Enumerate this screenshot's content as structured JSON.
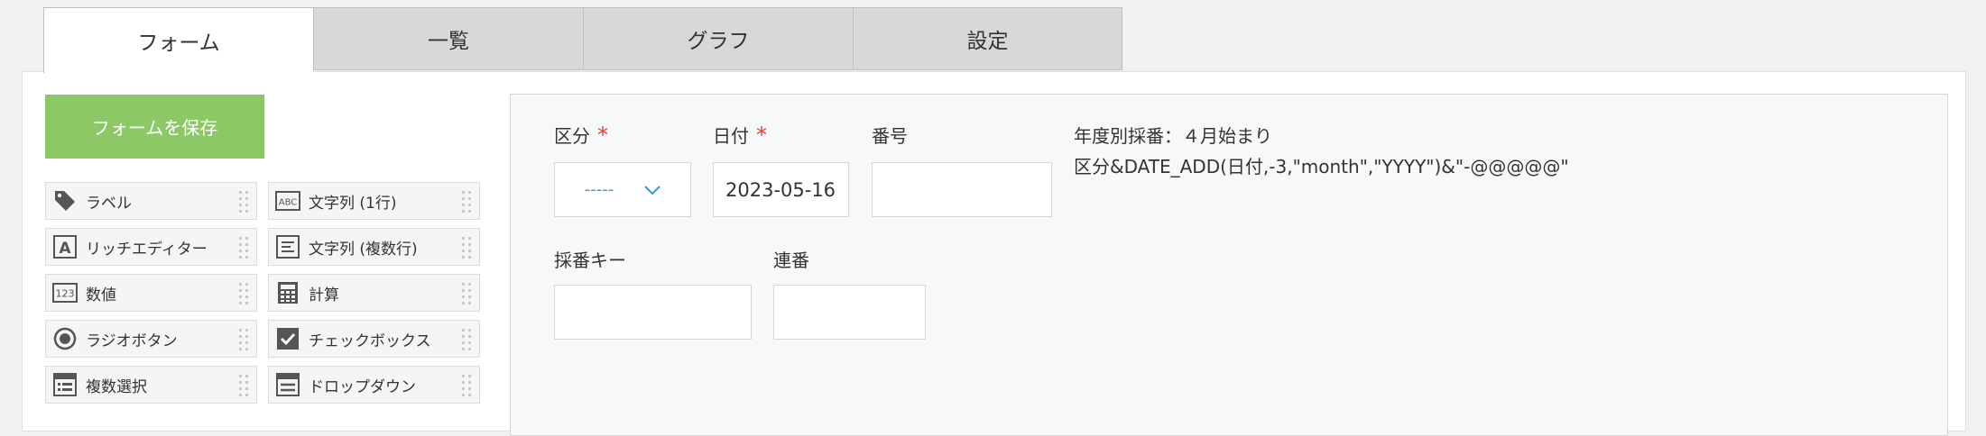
{
  "tabs": [
    {
      "label": "フォーム"
    },
    {
      "label": "一覧"
    },
    {
      "label": "グラフ"
    },
    {
      "label": "設定"
    }
  ],
  "save_button": "フォームを保存",
  "palette": [
    {
      "label": "ラベル",
      "icon": "tag-icon"
    },
    {
      "label": "文字列 (1行)",
      "icon": "abc-icon"
    },
    {
      "label": "リッチエディター",
      "icon": "rich-editor-icon"
    },
    {
      "label": "文字列 (複数行)",
      "icon": "multiline-text-icon"
    },
    {
      "label": "数値",
      "icon": "number-123-icon"
    },
    {
      "label": "計算",
      "icon": "calculator-icon"
    },
    {
      "label": "ラジオボタン",
      "icon": "radio-icon"
    },
    {
      "label": "チェックボックス",
      "icon": "checkbox-icon"
    },
    {
      "label": "複数選択",
      "icon": "multi-select-icon"
    },
    {
      "label": "ドロップダウン",
      "icon": "dropdown-icon"
    }
  ],
  "form": {
    "kubun": {
      "label": "区分",
      "required": "*",
      "value": "-----"
    },
    "date": {
      "label": "日付",
      "required": "*",
      "value": "2023-05-16"
    },
    "number": {
      "label": "番号",
      "value": ""
    },
    "note_line1": "年度別採番：４月始まり",
    "note_line2": "区分&DATE_ADD(日付,-3,\"month\",\"YYYY\")&\"-@@@@@\"",
    "saiban_key": {
      "label": "採番キー",
      "value": ""
    },
    "renban": {
      "label": "連番",
      "value": ""
    }
  },
  "colors": {
    "accent_green": "#8cc865",
    "required_red": "#e0403a",
    "link_blue": "#3498db"
  }
}
